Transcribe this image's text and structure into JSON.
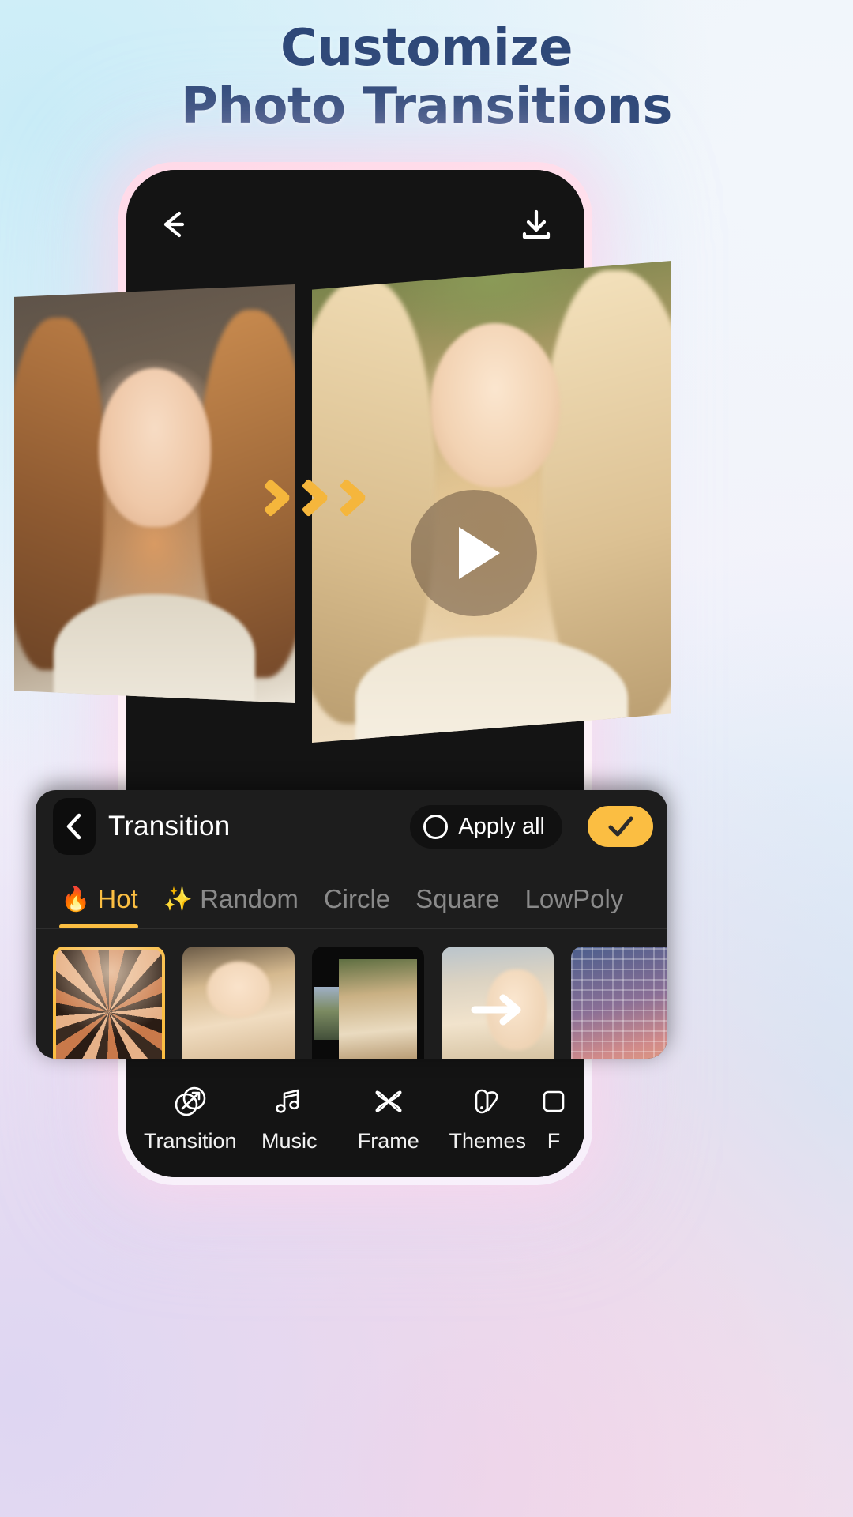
{
  "headline": {
    "line1": "Customize",
    "line2": "Photo Transitions"
  },
  "colors": {
    "accent": "#fbbe42",
    "headline": "#2e4878",
    "panel_bg": "#1d1d1d",
    "screen_bg": "#141414"
  },
  "phone": {
    "topbar": {
      "back_icon": "arrow-left-icon",
      "download_icon": "download-icon"
    },
    "preview": {
      "play_icon": "play-icon",
      "transition_indicator": "double-chevron-right-icon",
      "left_photo_alt": "portrait-photo-before",
      "right_photo_alt": "portrait-photo-after"
    }
  },
  "panel": {
    "back_icon": "chevron-left-icon",
    "title": "Transition",
    "apply_all_label": "Apply all",
    "apply_all_icon": "radio-circle-icon",
    "confirm_icon": "check-icon",
    "tabs": [
      {
        "label": "Hot",
        "emoji": "🔥",
        "active": true
      },
      {
        "label": "Random",
        "emoji": "✨",
        "active": false
      },
      {
        "label": "Circle",
        "emoji": "",
        "active": false
      },
      {
        "label": "Square",
        "emoji": "",
        "active": false
      },
      {
        "label": "LowPoly",
        "emoji": "",
        "active": false
      }
    ],
    "thumbnails": [
      {
        "name": "pinwheel-transition",
        "selected": true
      },
      {
        "name": "fade-transition",
        "selected": false
      },
      {
        "name": "slide-in-transition",
        "selected": false
      },
      {
        "name": "push-right-transition",
        "selected": false
      },
      {
        "name": "grid-transition",
        "selected": false
      }
    ]
  },
  "bottom_nav": [
    {
      "label": "Transition",
      "icon": "transition-icon"
    },
    {
      "label": "Music",
      "icon": "music-note-icon"
    },
    {
      "label": "Frame",
      "icon": "flower-frame-icon"
    },
    {
      "label": "Themes",
      "icon": "themes-icon"
    },
    {
      "label": "F",
      "icon": "more-icon"
    }
  ]
}
